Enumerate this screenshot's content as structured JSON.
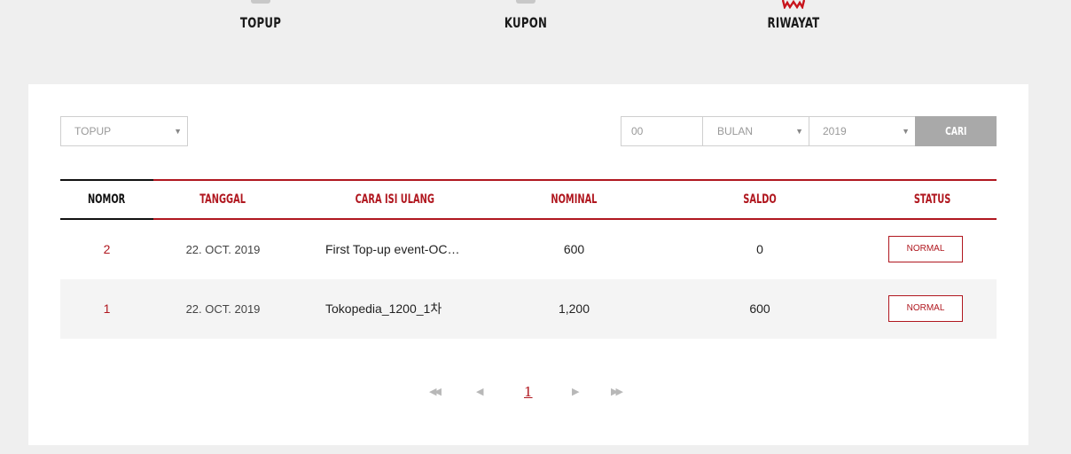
{
  "tabs": [
    {
      "label": "TOPUP"
    },
    {
      "label": "KUPON"
    },
    {
      "label": "RIWAYAT"
    }
  ],
  "filters": {
    "type_value": "TOPUP",
    "day_value": "00",
    "month_value": "BULAN",
    "year_value": "2019",
    "search_label": "CARI"
  },
  "table": {
    "headers": [
      "NOMOR",
      "TANGGAL",
      "CARA ISI ULANG",
      "NOMINAL",
      "SALDO",
      "STATUS"
    ],
    "rows": [
      {
        "no": "2",
        "date": "22. OCT. 2019",
        "method": "First Top-up event-OC…",
        "nominal": "600",
        "saldo": "0",
        "status": "NORMAL"
      },
      {
        "no": "1",
        "date": "22. OCT. 2019",
        "method": "Tokopedia_1200_1차",
        "nominal": "1,200",
        "saldo": "600",
        "status": "NORMAL"
      }
    ]
  },
  "pagination": {
    "first": "◀◀",
    "prev": "◀",
    "current": "1",
    "next": "▶",
    "last": "▶▶"
  },
  "colors": {
    "accent": "#b0171f",
    "button": "#a9a9a9"
  }
}
